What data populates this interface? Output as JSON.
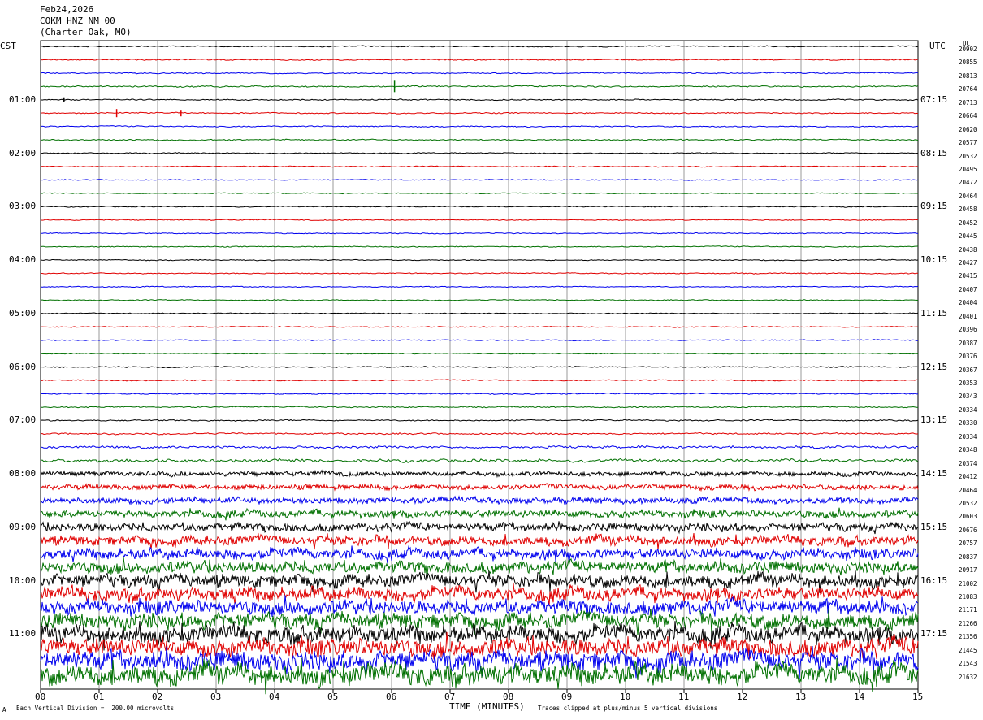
{
  "header": {
    "date": "Feb24,2026",
    "station": "COKM HNZ NM 00",
    "location": "(Charter Oak, MO)"
  },
  "left_tz": "CST",
  "right_tz": "UTC",
  "dc_label": "DC",
  "footer": {
    "scale": "Each Vertical Division =  200.00 microvolts",
    "clip": "Traces clipped at plus/minus 5 vertical divisions",
    "corner_mark": "A"
  },
  "chart_data": {
    "type": "line",
    "title": "",
    "xlabel": "TIME (MINUTES)",
    "x_ticks": [
      "00",
      "01",
      "02",
      "03",
      "04",
      "05",
      "06",
      "07",
      "08",
      "09",
      "10",
      "11",
      "12",
      "13",
      "14",
      "15"
    ],
    "xlim": [
      0,
      15
    ],
    "grid": true,
    "series_colors": [
      "#000000",
      "#e00000",
      "#0000ee",
      "#007000"
    ],
    "left_hour_labels": [
      "01:00",
      "02:00",
      "03:00",
      "04:00",
      "05:00",
      "06:00",
      "07:00",
      "08:00",
      "09:00",
      "10:00",
      "11:00"
    ],
    "right_hour_labels": [
      "07:15",
      "08:15",
      "09:15",
      "10:15",
      "11:15",
      "12:15",
      "13:15",
      "14:15",
      "15:15",
      "16:15",
      "17:15"
    ],
    "dc_offsets": [
      "20902",
      "20855",
      "20813",
      "20764",
      "20713",
      "20664",
      "20620",
      "20577",
      "20532",
      "20495",
      "20472",
      "20464",
      "20458",
      "20452",
      "20445",
      "20438",
      "20427",
      "20415",
      "20407",
      "20404",
      "20401",
      "20396",
      "20387",
      "20376",
      "20367",
      "20353",
      "20343",
      "20334",
      "20330",
      "20334",
      "20348",
      "20374",
      "20412",
      "20464",
      "20532",
      "20603",
      "20676",
      "20757",
      "20837",
      "20917",
      "21002",
      "21083",
      "21171",
      "21266",
      "21356",
      "21445",
      "21543",
      "21632"
    ],
    "trace_noise_levels": [
      0.6,
      0.6,
      0.6,
      0.7,
      0.6,
      0.6,
      0.6,
      0.6,
      0.5,
      0.5,
      0.5,
      0.5,
      0.5,
      0.5,
      0.5,
      0.5,
      0.5,
      0.5,
      0.5,
      0.5,
      0.5,
      0.5,
      0.5,
      0.5,
      0.6,
      0.6,
      0.6,
      0.6,
      0.7,
      0.8,
      1.2,
      1.6,
      2.2,
      2.6,
      3.0,
      3.6,
      4.0,
      4.6,
      5.2,
      5.8,
      6.2,
      6.6,
      7.0,
      7.6,
      8.2,
      8.8,
      9.4,
      10.0
    ]
  }
}
